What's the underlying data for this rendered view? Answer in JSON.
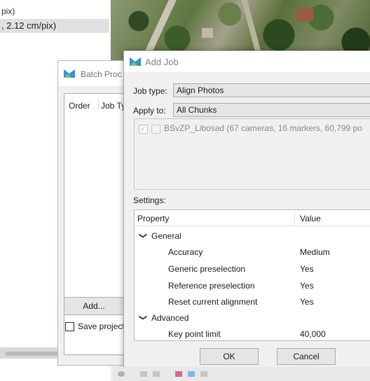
{
  "background": {
    "line1": "pix)",
    "line2": ", 2.12 cm/pix)"
  },
  "batch_window": {
    "title": "Batch Proc",
    "columns": [
      "Order",
      "Job Ty"
    ],
    "add_button": "Add...",
    "save_project_label": "Save project"
  },
  "dialog": {
    "title": "Add Job",
    "job_type_label": "Job type:",
    "job_type_value": "Align Photos",
    "apply_to_label": "Apply to:",
    "apply_to_value": "All Chunks",
    "chunk_text": "BSvZP_Libosad (67 cameras, 16 markers, 60,799 po",
    "settings_label": "Settings:",
    "table": {
      "col_property": "Property",
      "col_value": "Value",
      "group_general": "General",
      "rows_general": [
        {
          "property": "Accuracy",
          "value": "Medium"
        },
        {
          "property": "Generic preselection",
          "value": "Yes"
        },
        {
          "property": "Reference preselection",
          "value": "Yes"
        },
        {
          "property": "Reset current alignment",
          "value": "Yes"
        }
      ],
      "group_advanced": "Advanced",
      "rows_advanced": [
        {
          "property": "Key point limit",
          "value": "40,000"
        }
      ]
    },
    "ok_button": "OK",
    "cancel_button": "Cancel"
  },
  "colors": {
    "accent_icon": "#3b8fd6",
    "dialog_bg": "#f0f0f0"
  }
}
